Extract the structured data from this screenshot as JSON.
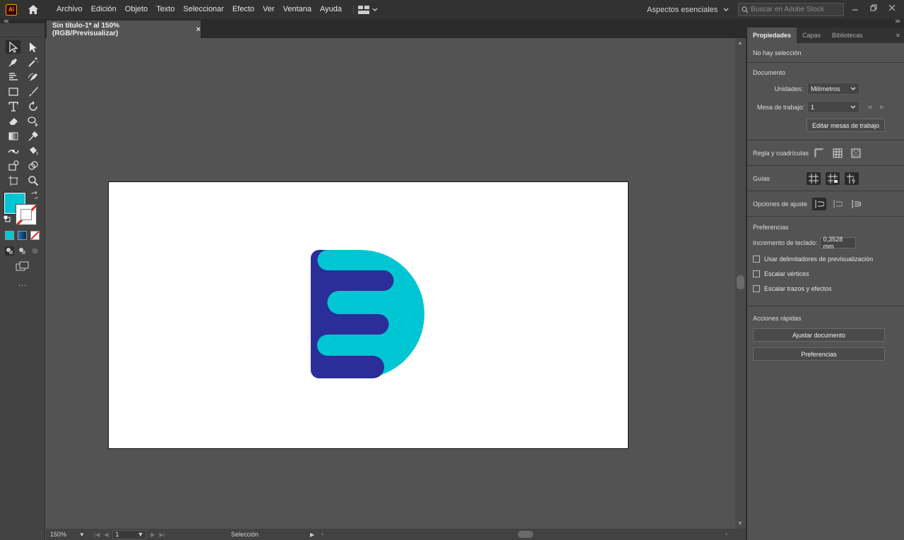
{
  "app": {
    "logo_text": "Ai",
    "menu": [
      "Archivo",
      "Edición",
      "Objeto",
      "Texto",
      "Seleccionar",
      "Efecto",
      "Ver",
      "Ventana",
      "Ayuda"
    ],
    "workspace": "Aspectos esenciales",
    "search_placeholder": "Buscar en Adobe Stock"
  },
  "document": {
    "tab_title": "Sin título-1* al 150% (RGB/Previsualizar)",
    "close_glyph": "×"
  },
  "toolbar": {
    "fill_color": "#00c6d4",
    "stroke_color": "none",
    "tools": [
      "selection-tool",
      "direct-selection-tool",
      "pen-tool",
      "magic-wand-tool",
      "type-on-path-tool",
      "curvature-tool",
      "rectangle-tool",
      "paintbrush-tool",
      "type-tool",
      "rotate-tool",
      "eraser-tool",
      "shape-builder-tool",
      "gradient-tool",
      "eyedropper-tool",
      "width-tool",
      "live-paint-tool",
      "symbol-sprayer-tool",
      "blend-tool",
      "artboard-tool",
      "zoom-tool"
    ],
    "more_glyph": "..."
  },
  "artwork": {
    "primary_color": "#00c6d4",
    "secondary_color": "#2b2d98"
  },
  "status": {
    "zoom": "150%",
    "artboard_number": "1",
    "tool_label": "Selección"
  },
  "panel": {
    "tabs": [
      "Propiedades",
      "Capas",
      "Bibliotecas"
    ],
    "selection_text": "No hay selección",
    "document_header": "Documento",
    "units_label": "Unidades:",
    "units_value": "Milímetros",
    "artboard_label": "Mesa de trabajo:",
    "artboard_value": "1",
    "edit_artboards_button": "Editar mesas de trabajo",
    "rulers_label": "Regla y cuadrículas",
    "guides_label": "Guías",
    "snap_label": "Opciones de ajuste",
    "preferences_header": "Preferencias",
    "keyboard_increment_label": "Incremento de teclado:",
    "keyboard_increment_value": "0,3528 mm",
    "checkbox_preview_bounds": "Usar delimitadores de previsualización",
    "checkbox_scale_corners": "Escalar vértices",
    "checkbox_scale_strokes": "Escalar trazos y efectos",
    "quick_actions_header": "Acciones rápidas",
    "fit_document_button": "Ajustar documento",
    "preferences_button": "Preferencias"
  }
}
